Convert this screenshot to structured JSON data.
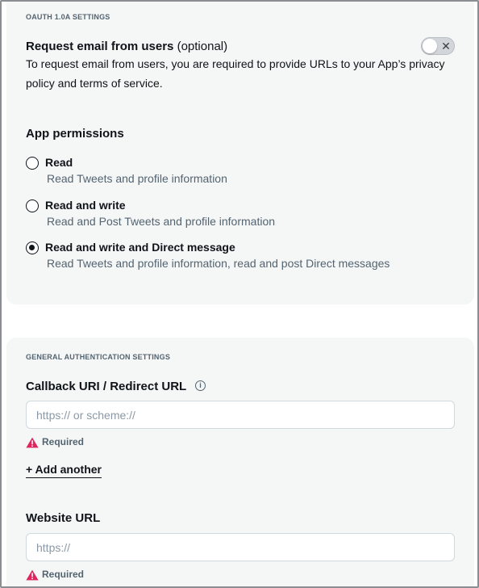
{
  "oauth": {
    "section_label": "OAUTH 1.0A SETTINGS",
    "request_email": {
      "title": "Request email from users",
      "optional": " (optional)",
      "description": "To request email from users, you are required to provide URLs to your App’s privacy policy and terms of service.",
      "toggle_icon": "close-icon",
      "toggle_glyph": "✕",
      "enabled": false
    },
    "permissions_title": "App permissions",
    "permissions": [
      {
        "label": "Read",
        "description": "Read Tweets and profile information",
        "selected": false
      },
      {
        "label": "Read and write",
        "description": "Read and Post Tweets and profile information",
        "selected": false
      },
      {
        "label": "Read and write and Direct message",
        "description": "Read Tweets and profile information, read and post Direct messages",
        "selected": true
      }
    ]
  },
  "general": {
    "section_label": "GENERAL AUTHENTICATION SETTINGS",
    "callback": {
      "label": "Callback URI / Redirect URL",
      "info_glyph": "i",
      "placeholder": "https:// or scheme://",
      "value": "",
      "required_text": "Required"
    },
    "add_another": "+ Add another",
    "website": {
      "label": "Website URL",
      "placeholder": "https://",
      "value": "",
      "required_text": "Required"
    }
  },
  "colors": {
    "panel_bg": "#f5f6f6",
    "warning_red": "#e0245e",
    "muted_text": "#536471"
  }
}
